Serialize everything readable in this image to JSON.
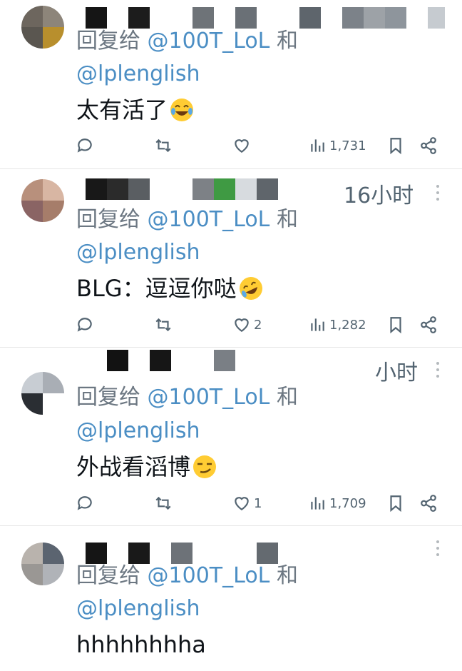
{
  "tweets": [
    {
      "time": "",
      "reply_prefix": "回复给",
      "reply_mention1": "@100T_LoL",
      "reply_and": "和",
      "reply_mention2": "@lplenglish",
      "text": "太有活了",
      "emoji": "tears-of-joy-emoji",
      "likes": "",
      "views": "1,731"
    },
    {
      "time": "16小时",
      "reply_prefix": "回复给",
      "reply_mention1": "@100T_LoL",
      "reply_and": "和",
      "reply_mention2": "@lplenglish",
      "text": "BLG：逗逗你哒",
      "emoji": "rolling-laughing-emoji",
      "likes": "2",
      "views": "1,282"
    },
    {
      "time": "小时",
      "reply_prefix": "回复给",
      "reply_mention1": "@100T_LoL",
      "reply_and": "和",
      "reply_mention2": "@lplenglish",
      "text": "外战看滔博",
      "emoji": "smirk-emoji",
      "likes": "1",
      "views": "1,709"
    },
    {
      "time": "",
      "reply_prefix": "回复给",
      "reply_mention1": "@100T_LoL",
      "reply_and": "和",
      "reply_mention2": "@lplenglish",
      "text": "hhhhhhhha",
      "emoji": "",
      "likes": "",
      "views": ""
    }
  ],
  "colors": {
    "mention": "#4b8ec4",
    "muted": "#536471",
    "separator": "#e6e6e6"
  }
}
